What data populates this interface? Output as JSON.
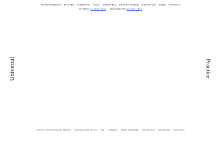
{
  "top_nav": {
    "items": [
      {
        "label": "Physiotherapy"
      },
      {
        "label": "Pilates"
      },
      {
        "label": "Strength"
      },
      {
        "label": "Yoga"
      },
      {
        "label": "Timetable"
      },
      {
        "label": "Practitioners"
      },
      {
        "label": "Education"
      },
      {
        "label": "News"
      },
      {
        "label": "Contact"
      }
    ]
  },
  "phones": {
    "left_prefix": "Fitzroy",
    "left_number": "03 9999 1800",
    "right_prefix": "Malvern PR",
    "right_number": "03 9999 1800"
  },
  "side": {
    "left": "Universal",
    "right": "Practice"
  },
  "footer_nav": {
    "items": [
      {
        "label": "Faults / Private Health Rebate"
      },
      {
        "label": "Cancellation Policy"
      },
      {
        "label": "FAQ"
      },
      {
        "label": "Careers"
      },
      {
        "label": "Media Enquiries"
      },
      {
        "label": "Telehealth"
      },
      {
        "label": "Instagram"
      },
      {
        "label": "Locations"
      }
    ]
  },
  "colors": {
    "background": "#ffffff",
    "text": "#222222",
    "link_accent": "#3a6fd8"
  }
}
